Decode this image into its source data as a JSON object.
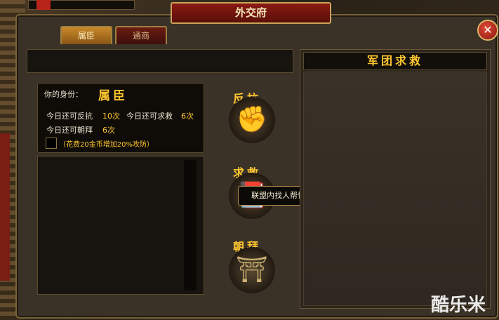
{
  "window": {
    "title": "外交府",
    "close_label": "✕"
  },
  "tabs": [
    {
      "label": "属臣",
      "active": true
    },
    {
      "label": "通商",
      "active": false
    }
  ],
  "status": {
    "identity_label": "你的身份：",
    "identity_value": "属臣",
    "revolt_label": "今日还可反抗",
    "revolt_count": "10次",
    "rescue_label": "今日还可求救",
    "rescue_count": "6次",
    "tribute_label": "今日还可朝拜",
    "tribute_count": "6次",
    "option_text": "（花费20金币增加20%攻防）"
  },
  "actions": [
    {
      "title": "反抗",
      "icon": "fist-icon"
    },
    {
      "title": "求救",
      "icon": "book-icon"
    },
    {
      "title": "朝拜",
      "icon": "incense-urn-icon"
    }
  ],
  "tooltip": "联盟内找人帮忙解救自己。",
  "right_panel": {
    "title": "军团求救"
  },
  "watermark": "酷乐米",
  "colors": {
    "accent_gold": "#ffc62e",
    "title_red": "#8a1a12",
    "panel_border": "#7a6238"
  }
}
